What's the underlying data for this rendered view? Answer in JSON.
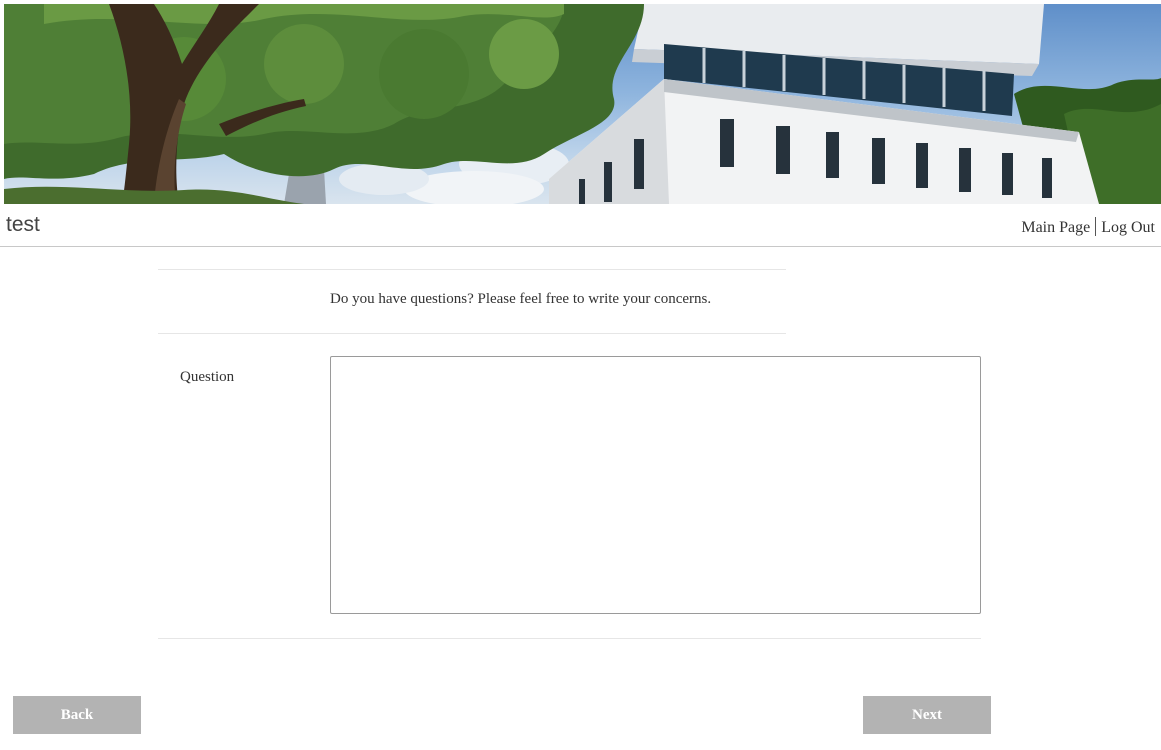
{
  "banner": {
    "image": "campus-building-with-tree"
  },
  "header": {
    "site_title": "test",
    "links": {
      "main_page": "Main Page",
      "log_out": "Log Out"
    }
  },
  "form": {
    "intro_text": "Do you have questions? Please feel free to write your concerns.",
    "question_label": "Question",
    "question_value": ""
  },
  "buttons": {
    "back": "Back",
    "next": "Next"
  },
  "colors": {
    "button_bg": "#b3b3b3",
    "button_text": "#ffffff",
    "rule": "#e6e6e6"
  }
}
